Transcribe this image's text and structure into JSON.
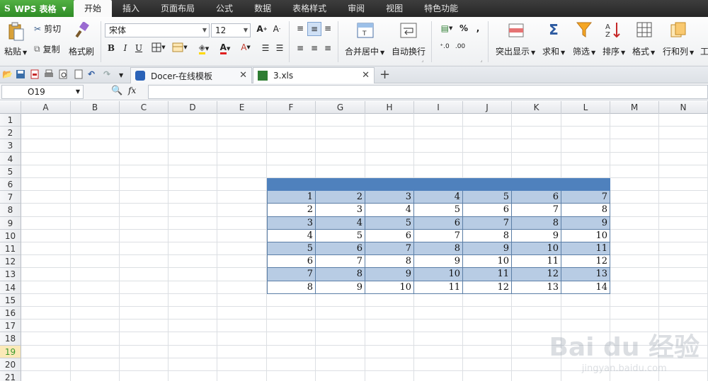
{
  "app": {
    "logo": "S",
    "name": "WPS 表格"
  },
  "menu": {
    "tabs": [
      "开始",
      "插入",
      "页面布局",
      "公式",
      "数据",
      "表格样式",
      "审阅",
      "视图",
      "特色功能"
    ],
    "active": "开始"
  },
  "ribbon": {
    "paste": "粘贴",
    "cut": "剪切",
    "copy": "复制",
    "format_painter": "格式刷",
    "font_name": "宋体",
    "font_size": "12",
    "bold": "B",
    "italic": "I",
    "underline": "U",
    "merge_center": "合并居中",
    "wrap_text": "自动换行",
    "percent": "%",
    "comma": ",",
    "highlight": "突出显示",
    "sum": "求和",
    "filter": "筛选",
    "sort": "排序",
    "format": "格式",
    "row_col": "行和列",
    "work": "工"
  },
  "doc_tabs": [
    {
      "label": "Docer-在线模板"
    },
    {
      "label": "3.xls"
    }
  ],
  "formula_bar": {
    "cell_ref": "O19",
    "fx": "fx",
    "value": ""
  },
  "columns": [
    "A",
    "B",
    "C",
    "D",
    "E",
    "F",
    "G",
    "H",
    "I",
    "J",
    "K",
    "L",
    "M",
    "N"
  ],
  "rows": [
    "1",
    "2",
    "3",
    "4",
    "5",
    "6",
    "7",
    "8",
    "9",
    "10",
    "11",
    "12",
    "13",
    "14",
    "15",
    "16",
    "17",
    "18",
    "19",
    "20",
    "21"
  ],
  "selected_row": "19",
  "table": {
    "header_color": "#4f81bd",
    "band_color": "#b8cce4",
    "values": [
      [
        1,
        2,
        3,
        4,
        5,
        6,
        7
      ],
      [
        2,
        3,
        4,
        5,
        6,
        7,
        8
      ],
      [
        3,
        4,
        5,
        6,
        7,
        8,
        9
      ],
      [
        4,
        5,
        6,
        7,
        8,
        9,
        10
      ],
      [
        5,
        6,
        7,
        8,
        9,
        10,
        11
      ],
      [
        6,
        7,
        8,
        9,
        10,
        11,
        12
      ],
      [
        7,
        8,
        9,
        10,
        11,
        12,
        13
      ],
      [
        8,
        9,
        10,
        11,
        12,
        13,
        14
      ]
    ]
  },
  "watermark": {
    "line1": "Bai du 经验",
    "line2": "jingyan.baidu.com"
  }
}
